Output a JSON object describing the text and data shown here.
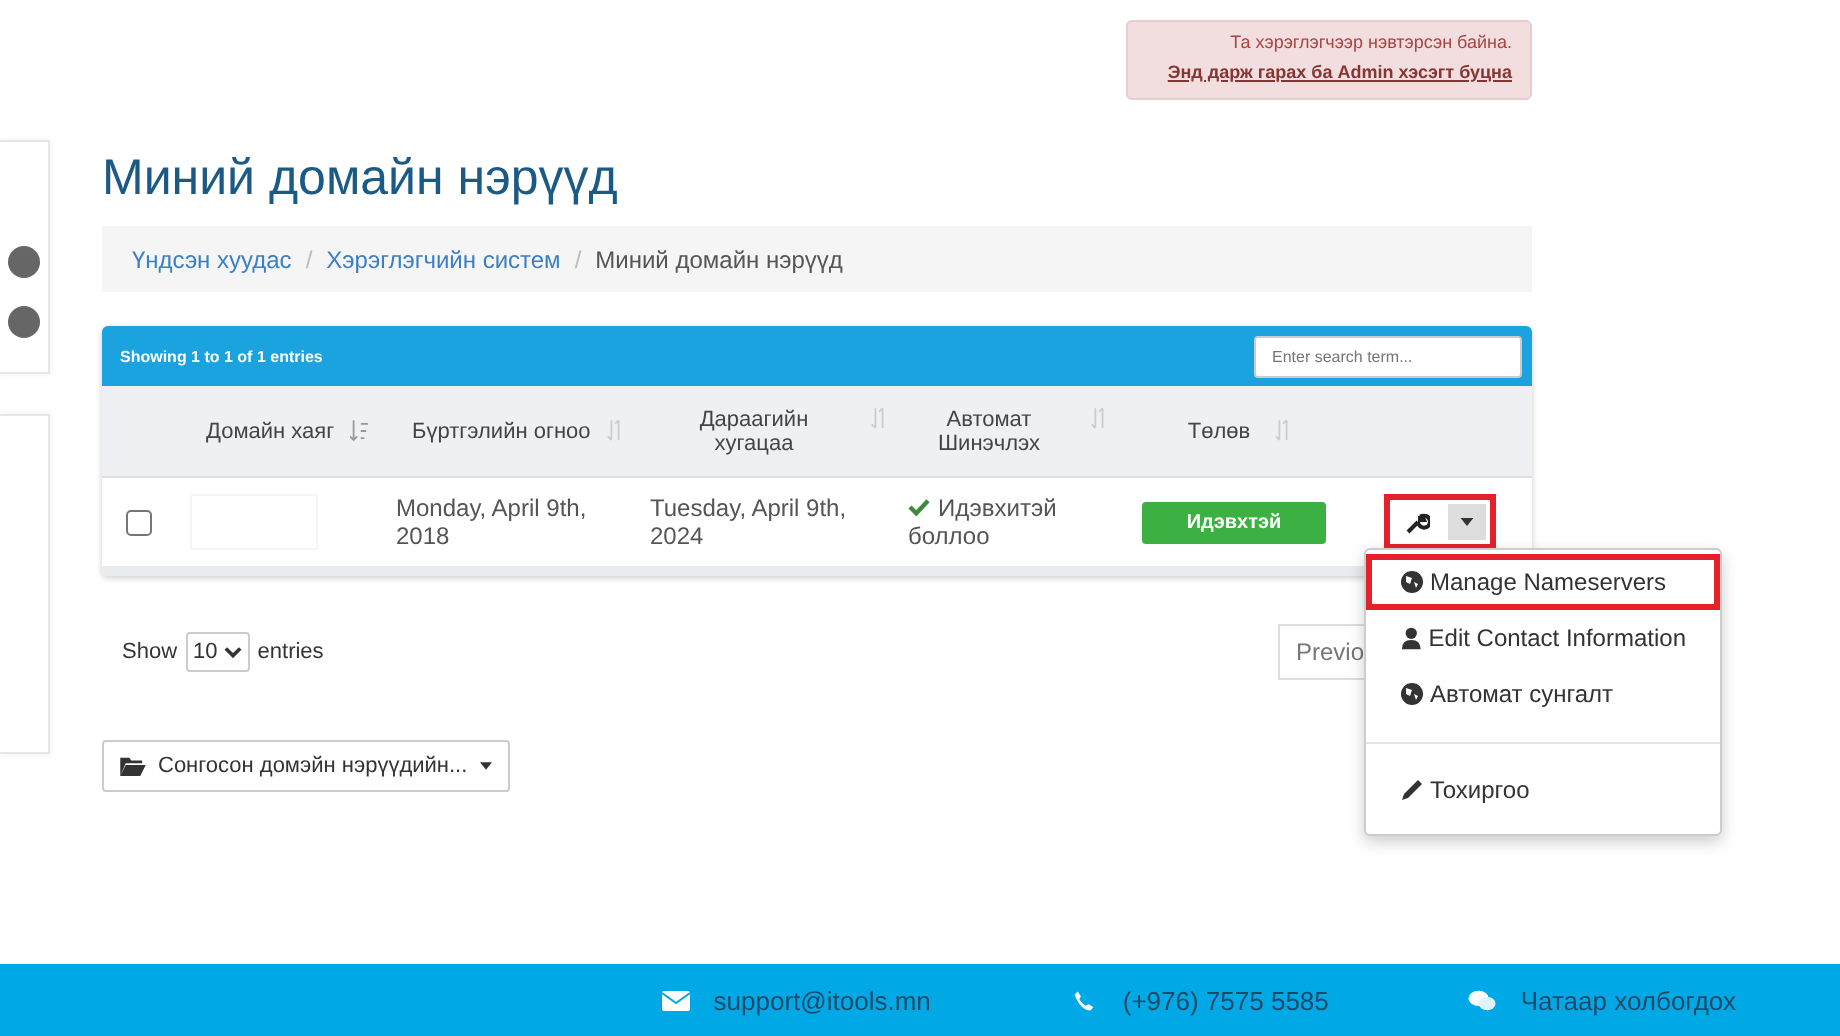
{
  "impersonation_alert": {
    "message": "Та хэрэглэгчээр нэвтэрсэн байна.",
    "link": "Энд дарж гарах ба Admin хэсэгт буцна"
  },
  "page_title": "Миний домайн нэрүүд",
  "breadcrumb_separator": "/",
  "breadcrumb": [
    {
      "label": "Үндсэн хуудас",
      "current": false
    },
    {
      "label": "Хэрэглэгчийн систем",
      "current": false
    },
    {
      "label": "Миний домайн нэрүүд",
      "current": true
    }
  ],
  "table": {
    "info": "Showing 1 to 1 of 1 entries",
    "search": {
      "placeholder": "Enter search term..."
    },
    "columns": [
      {
        "label": "Домайн хаяг",
        "sorted": true
      },
      {
        "label": "Бүртгэлийн огноо",
        "sorted": false
      },
      {
        "label": "Дараагийн хугацаа",
        "sorted": false
      },
      {
        "label": "Автомат Шинэчлэх",
        "sorted": false
      },
      {
        "label": "Төлөв",
        "sorted": false
      }
    ],
    "rows": [
      {
        "checked": false,
        "registered": "Monday, April 9th, 2018",
        "next_due": "Tuesday, April 9th, 2024",
        "auto_renew": "Идэвхитэй боллоо",
        "status": "Идэвхтэй"
      }
    ]
  },
  "length": {
    "label_before": "Show",
    "value": "10",
    "label_after": "entries"
  },
  "pagination": {
    "previous": "Previo"
  },
  "bulk_button": "Сонгосон домэйн нэрүүдийн...",
  "action_menu": [
    {
      "label": "Manage Nameservers",
      "kind": "globe",
      "highlighted": true,
      "divider_before": false
    },
    {
      "label": "Edit Contact Information",
      "kind": "user",
      "highlighted": false,
      "divider_before": false
    },
    {
      "label": "Автомат сунгалт",
      "kind": "globe",
      "highlighted": false,
      "divider_before": false
    },
    {
      "label": "Тохиргоо",
      "kind": "pencil",
      "highlighted": false,
      "divider_before": true
    }
  ],
  "footer": [
    {
      "kind": "mail",
      "text": "support@itools.mn"
    },
    {
      "kind": "phone",
      "text": "(+976) 7575 5585"
    },
    {
      "kind": "chat",
      "text": "Чатаар холбогдох"
    }
  ]
}
